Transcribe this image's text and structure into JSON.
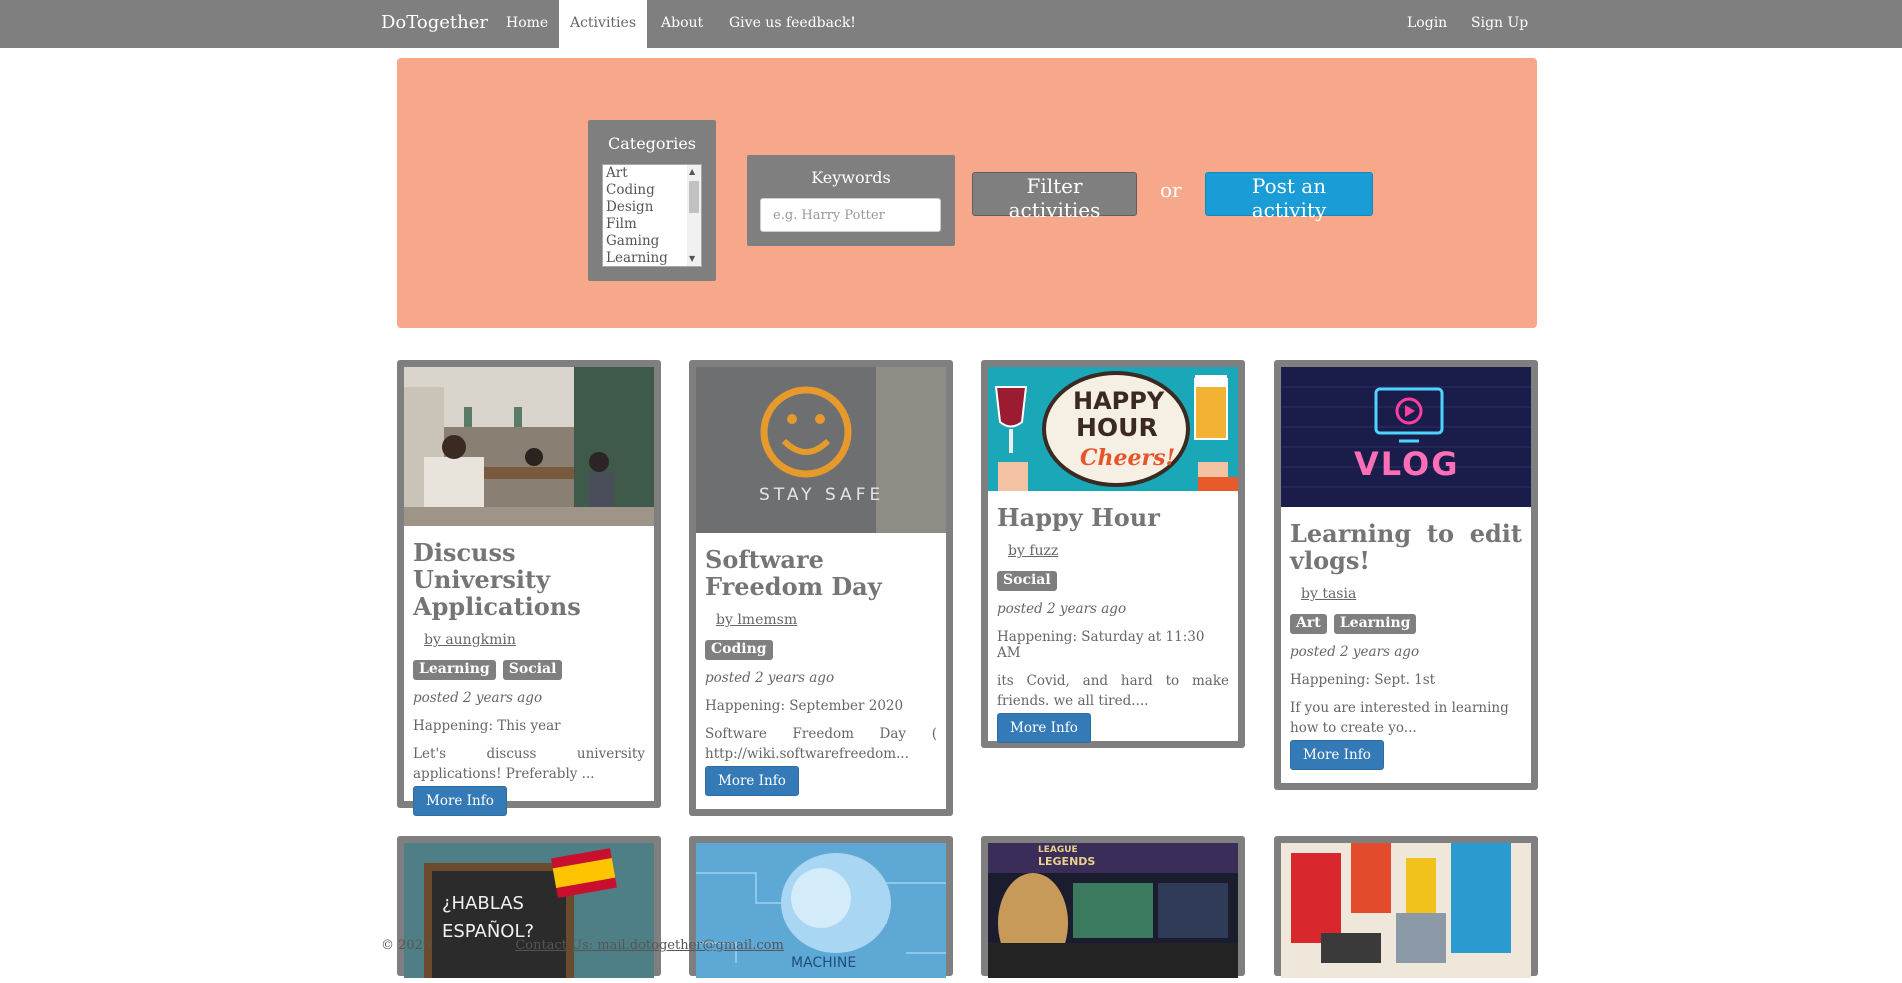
{
  "nav": {
    "brand": "DoTogether",
    "links": [
      "Home",
      "Activities",
      "About",
      "Give us feedback!"
    ],
    "right_links": [
      "Login",
      "Sign Up"
    ]
  },
  "filter": {
    "categories_title": "Categories",
    "categories": [
      "Art",
      "Coding",
      "Design",
      "Film",
      "Gaming",
      "Learning"
    ],
    "keywords_title": "Keywords",
    "keywords_placeholder": "e.g. Harry Potter",
    "filter_button": "Filter activities",
    "or_label": "or",
    "post_button": "Post an activity"
  },
  "colors": {
    "navbar": "#7f7f7f",
    "panel": "#f7a88b",
    "post_button": "#1a9cd6",
    "more_button": "#337ab7",
    "card_border": "#7f7f7f"
  },
  "cards": [
    {
      "title": "Discuss University Applications",
      "author": "by aungkmin",
      "tags": [
        "Learning",
        "Social"
      ],
      "posted": "posted 2 years ago",
      "happening": "Happening: This year",
      "description": "Let's discuss university applications! Preferably ...",
      "button": "More Info",
      "image": "cafe-photo"
    },
    {
      "title": "Software Freedom Day",
      "author": "by lmemsm",
      "tags": [
        "Coding"
      ],
      "posted": "posted 2 years ago",
      "happening": "Happening: September 2020",
      "description": "Software Freedom Day ( http://wiki.softwarefreedom...",
      "button": "More Info",
      "image": "stay-safe-photo",
      "image_text": "STAY SAFE"
    },
    {
      "title": "Happy Hour",
      "author": "by fuzz",
      "tags": [
        "Social"
      ],
      "posted": "posted 2 years ago",
      "happening": "Happening: Saturday at 11:30 AM",
      "description": "its Covid, and hard to make friends. we all tired....",
      "button": "More Info",
      "image": "happy-hour-illustration",
      "image_text": [
        "HAPPY",
        "HOUR",
        "Cheers!"
      ]
    },
    {
      "title": "Learning to edit vlogs!",
      "author": "by tasia",
      "tags": [
        "Art",
        "Learning"
      ],
      "posted": "posted 2 years ago",
      "happening": "Happening: Sept. 1st",
      "description": "If you are interested in learning how to create yo...",
      "button": "More Info",
      "image": "vlog-neon-sign",
      "image_text": "VLOG"
    }
  ],
  "row2_images": [
    {
      "image": "hablas-espanol-chalkboard",
      "image_text": [
        "¿HABLAS",
        "ESPAÑOL?"
      ]
    },
    {
      "image": "machine-learning-brain",
      "image_text": "MACHINE"
    },
    {
      "image": "league-of-legends-gaming",
      "image_text": [
        "LEAGUE",
        "LEGENDS"
      ]
    },
    {
      "image": "abstract-painting"
    }
  ],
  "footer": {
    "copyright": "© 2020",
    "contact": "Contact Us: mail.dotogether@gmail.com"
  }
}
